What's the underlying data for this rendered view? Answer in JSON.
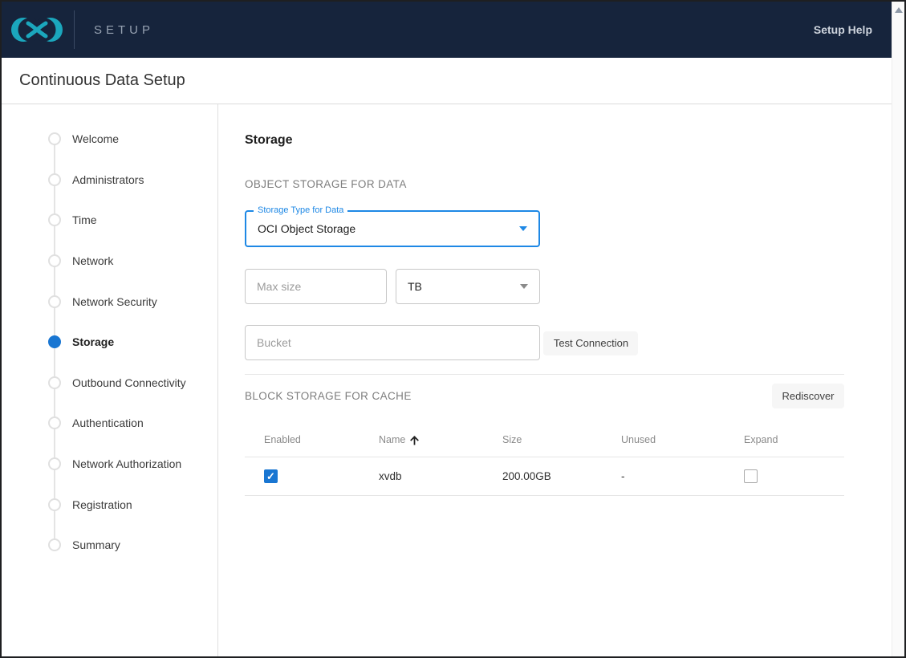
{
  "appbar": {
    "product": "SETUP",
    "help_label": "Setup Help",
    "bg_color": "#16243c",
    "logo_color": "#1ba7bd"
  },
  "page": {
    "title": "Continuous Data Setup"
  },
  "stepper": {
    "accent_color": "#1976d2",
    "items": [
      {
        "label": "Welcome",
        "active": false
      },
      {
        "label": "Administrators",
        "active": false
      },
      {
        "label": "Time",
        "active": false
      },
      {
        "label": "Network",
        "active": false
      },
      {
        "label": "Network Security",
        "active": false
      },
      {
        "label": "Storage",
        "active": true
      },
      {
        "label": "Outbound Connectivity",
        "active": false
      },
      {
        "label": "Authentication",
        "active": false
      },
      {
        "label": "Network Authorization",
        "active": false
      },
      {
        "label": "Registration",
        "active": false
      },
      {
        "label": "Summary",
        "active": false
      }
    ]
  },
  "content": {
    "heading": "Storage",
    "object_storage": {
      "section_title": "OBJECT STORAGE FOR DATA",
      "storage_type": {
        "label": "Storage Type for Data",
        "value": "OCI Object Storage",
        "border_color": "#1e88e5"
      },
      "max_size": {
        "placeholder": "Max size",
        "value": ""
      },
      "unit": {
        "value": "TB"
      },
      "bucket": {
        "placeholder": "Bucket",
        "value": ""
      },
      "test_button": "Test Connection"
    },
    "block_storage": {
      "section_title": "BLOCK STORAGE FOR CACHE",
      "rediscover_button": "Rediscover",
      "table": {
        "columns": [
          "Enabled",
          "Name",
          "Size",
          "Unused",
          "Expand"
        ],
        "sorted_by": "Name",
        "sort_direction": "ascending",
        "rows": [
          {
            "enabled": true,
            "name": "xvdb",
            "size": "200.00GB",
            "unused": "-",
            "expand": false
          }
        ]
      }
    }
  }
}
